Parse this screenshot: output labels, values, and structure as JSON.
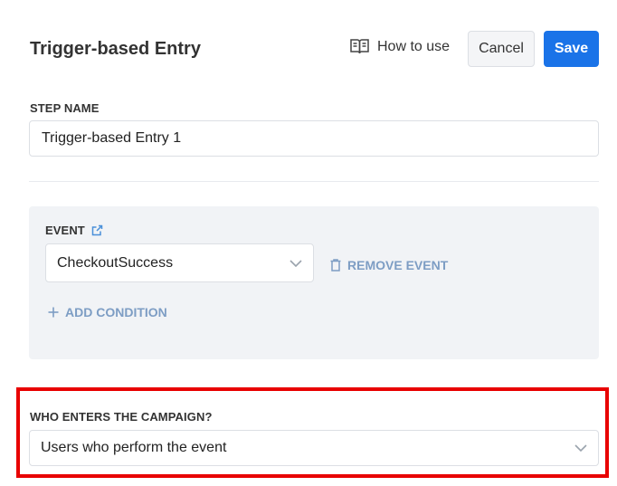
{
  "header": {
    "title": "Trigger-based Entry",
    "how_to_use": "How to use",
    "cancel_label": "Cancel",
    "save_label": "Save"
  },
  "step_name": {
    "label": "STEP NAME",
    "value": "Trigger-based Entry 1"
  },
  "event": {
    "label": "EVENT",
    "selected": "CheckoutSuccess",
    "remove_label": "REMOVE EVENT",
    "add_condition_label": "ADD CONDITION"
  },
  "who_enters": {
    "label": "WHO ENTERS THE CAMPAIGN?",
    "selected": "Users who perform the event"
  },
  "colors": {
    "primary": "#1a73e8",
    "link": "#7d9dc4",
    "highlight": "#e80000",
    "panel_bg": "#f1f3f6"
  },
  "icons": [
    "book-icon",
    "external-link-icon",
    "chevron-down-icon",
    "trash-icon",
    "plus-icon"
  ]
}
